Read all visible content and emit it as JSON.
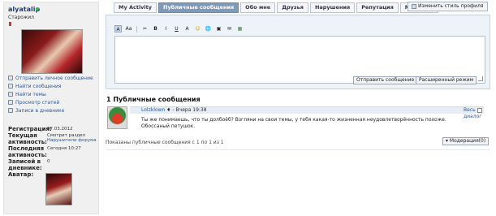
{
  "profile": {
    "username": "alyatalip",
    "title": "Старожил",
    "menu": [
      {
        "icon": "mail-icon",
        "label": "Отправить личное сообщение"
      },
      {
        "icon": "posts-icon",
        "label": "Найти сообщения"
      },
      {
        "icon": "threads-icon",
        "label": "Найти темы"
      },
      {
        "icon": "articles-icon",
        "label": "Просмотр статей"
      },
      {
        "icon": "diary-icon",
        "label": "Записи в дневнике"
      }
    ],
    "stats": {
      "reg_label": "Регистрация:",
      "reg_value": "07.03.2012",
      "activity_label": "Текущая активность:",
      "activity_value_prefix": "Смотрит раздел",
      "activity_value_link": "Нарушители форума",
      "last_label": "Последняя активность:",
      "last_value": "Сегодня 10:27",
      "diary_label": "Записей в дневнике:",
      "diary_value": "0",
      "avatar_label": "Аватар:"
    }
  },
  "tabs": [
    "My Activity",
    "Публичные сообщения",
    "Обо мне",
    "Друзья",
    "Нарушения",
    "Репутация",
    "My Ranks"
  ],
  "active_tab": "Публичные сообщения",
  "change_style_label": "Изменить стиль профиля",
  "editor": {
    "toolbar": [
      "A",
      "Aa",
      "✂",
      "B",
      "I",
      "U",
      "A",
      "☺",
      "🌐",
      "▣",
      "✉",
      "▦"
    ],
    "send_label": "Отправить сообщение",
    "advanced_label": "Расширенный режим"
  },
  "messages_section": {
    "title": "1 Публичные сообщения",
    "message": {
      "author": "Lolzklown",
      "meta": "Вчера    19:38",
      "dialog_link": "Весь диалог",
      "text_line1": "Ты же понимаешь, что ты долбоёб? Взгляни на свои темы, у тебя какая-то жизненная неудовлетворённость похоже.",
      "text_line2": "Обоссаный петушок."
    },
    "count_text": "Показаны публичные сообщения с 1 по 1 из 1",
    "moderation_label": "▾ Модерация(0)"
  },
  "colors": {
    "accent": "#7f9ab8",
    "link": "#2a5a9a",
    "online": "#39b54a"
  }
}
